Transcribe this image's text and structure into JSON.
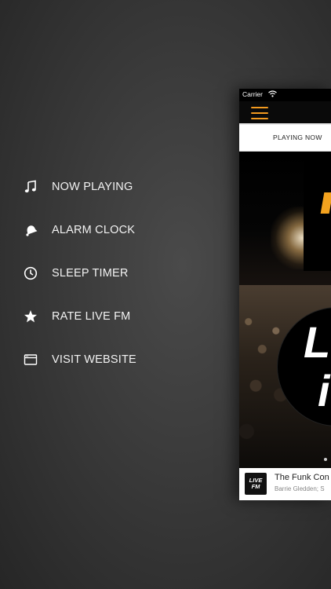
{
  "menu": {
    "items": [
      {
        "label": "NOW PLAYING",
        "icon": "music-note-icon"
      },
      {
        "label": "ALARM CLOCK",
        "icon": "alarm-bell-icon"
      },
      {
        "label": "SLEEP TIMER",
        "icon": "clock-icon"
      },
      {
        "label": "RATE LIVE FM",
        "icon": "star-icon"
      },
      {
        "label": "VISIT WEBSITE",
        "icon": "browser-window-icon"
      }
    ]
  },
  "app_preview": {
    "status_bar": {
      "carrier": "Carrier"
    },
    "tabs": [
      {
        "label": "PLAYING NOW",
        "active": true
      }
    ],
    "hero_letters": {
      "top": "L",
      "bottom": "i"
    },
    "now_playing": {
      "logo_line1": "LIVE",
      "logo_line2": "FM",
      "title": "The Funk Con",
      "artist": "Barrie Gledden; S"
    }
  },
  "colors": {
    "accent": "#f29a1f",
    "background": "#3a3a3a"
  }
}
